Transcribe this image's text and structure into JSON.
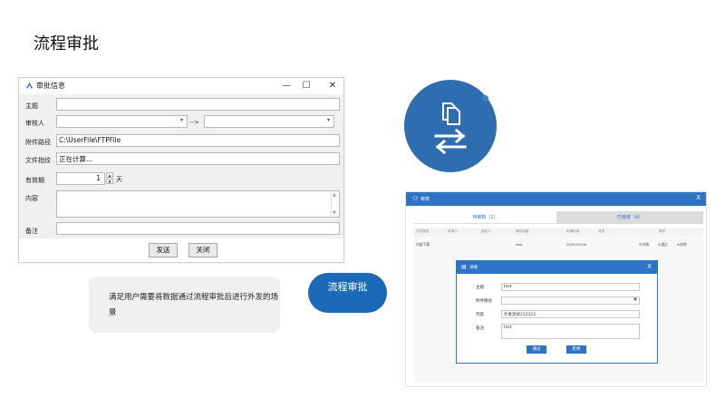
{
  "page": {
    "title": "流程审批"
  },
  "dialog": {
    "title": "审批信息",
    "labels": {
      "subject": "主题",
      "reviewer": "审核人",
      "attachment_path": "附件路径",
      "file_checksum": "文件指纹",
      "validity": "有效期",
      "content": "内容",
      "remark": "备注"
    },
    "values": {
      "subject": "",
      "reviewer_from": "",
      "reviewer_to": "",
      "attachment_path": "C:\\UserFile\\FTPFile",
      "file_checksum": "正在计算...",
      "validity": "1",
      "content": "",
      "remark": ""
    },
    "arrow_text": "-->",
    "validity_unit": "天",
    "buttons": {
      "send": "发送",
      "close": "关闭"
    },
    "window_controls": {
      "minimize": "—",
      "maximize": "☐",
      "close": "✕"
    }
  },
  "description": "满足用户需要将数据通过流程审批后进行外发的场景",
  "badge": "流程审批",
  "web": {
    "header_title": "审核",
    "close": "X",
    "tabs": {
      "pending": "待审核（1）",
      "reviewed": "已审核（4）"
    },
    "columns": [
      "外发类型",
      "申请人",
      "接收人",
      "邮件标题",
      "申请时间",
      "状态",
      "操作"
    ],
    "row": {
      "type": "内部下载",
      "title": "test",
      "time": "2020-03-09"
    },
    "actions": {
      "detail": "详情",
      "approve": "通过",
      "reject": "拒绝"
    },
    "inner_dialog": {
      "title": "详情",
      "labels": {
        "subject": "主题",
        "attachment_path": "附件路径",
        "content": "内容",
        "remark": "备注"
      },
      "values": {
        "subject": "test",
        "attachment_path": "",
        "content": "外发测试212312",
        "remark": "test"
      },
      "buttons": {
        "approve": "通过",
        "reject": "拒绝"
      }
    }
  }
}
